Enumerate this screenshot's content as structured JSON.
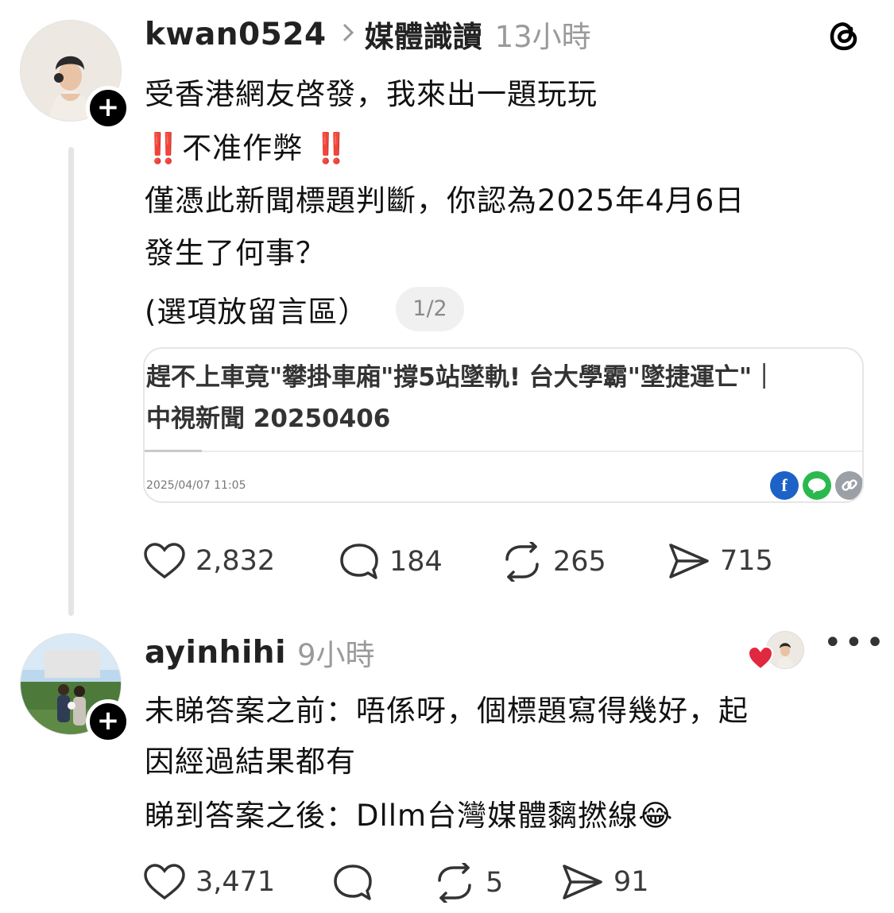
{
  "post": {
    "username": "kwan0524",
    "topic": "媒體識讀",
    "time": "13小時",
    "lines": [
      "受香港網友啓發，我來出一題玩玩",
      "‼️不准作弊 ‼️",
      "僅憑此新聞標題判斷，你認為2025年4月6日",
      "發生了何事？",
      "(選項放留言區）"
    ],
    "pager": "1/2",
    "card": {
      "title_line1": "趕不上車竟\"攀掛車廂\"撐5站墜軌! 台大學霸\"墜捷運亡\"｜",
      "title_line2": "中視新聞 20250406",
      "date": "2025/04/07 11:05",
      "share_icons": [
        "f",
        "LINE",
        "🔗"
      ]
    },
    "stats": {
      "likes": "2,832",
      "comments": "184",
      "reposts": "265",
      "shares": "715"
    }
  },
  "reply": {
    "username": "ayinhihi",
    "time": "9小時",
    "lines": [
      "未睇答案之前：唔係呀，個標題寫得幾好，起",
      "因經過結果都有",
      "睇到答案之後：Dllm台灣媒體黐撚線😂"
    ],
    "stats": {
      "likes": "3,471",
      "comments": "",
      "reposts": "5",
      "shares": "91"
    }
  },
  "colors": {
    "like_heart": "#e0283f",
    "facebook": "#1c62c7",
    "line": "#2bb94e",
    "link": "#9aa0a6",
    "muted": "#9a9a9a"
  },
  "icons": [
    "threads-logo-icon",
    "heart-icon",
    "comment-icon",
    "repost-icon",
    "send-icon",
    "more-icon",
    "plus-icon"
  ]
}
